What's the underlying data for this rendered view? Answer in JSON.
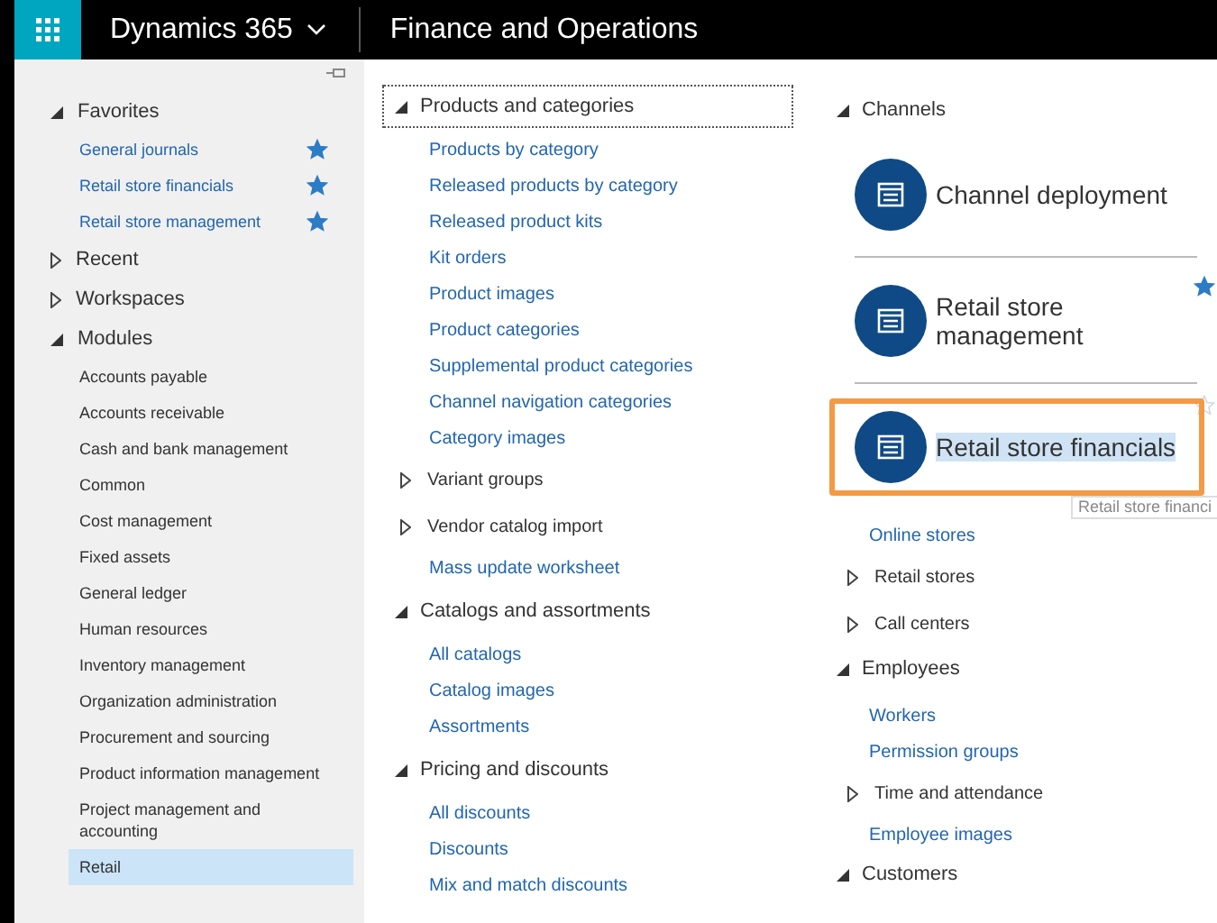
{
  "header": {
    "app_name": "Dynamics 365",
    "module_title": "Finance and Operations"
  },
  "sidebar": {
    "sections": [
      {
        "label": "Favorites",
        "expanded": true,
        "items": [
          {
            "label": "General journals",
            "starred": true,
            "selected": false
          },
          {
            "label": "Retail store financials",
            "starred": true,
            "selected": false
          },
          {
            "label": "Retail store management",
            "starred": true,
            "selected": false
          }
        ]
      },
      {
        "label": "Recent",
        "expanded": false
      },
      {
        "label": "Workspaces",
        "expanded": false
      },
      {
        "label": "Modules",
        "expanded": true,
        "items": [
          {
            "label": "Accounts payable",
            "starred": false,
            "selected": false
          },
          {
            "label": "Accounts receivable",
            "starred": false,
            "selected": false
          },
          {
            "label": "Cash and bank management",
            "starred": false,
            "selected": false
          },
          {
            "label": "Common",
            "starred": false,
            "selected": false
          },
          {
            "label": "Cost management",
            "starred": false,
            "selected": false
          },
          {
            "label": "Fixed assets",
            "starred": false,
            "selected": false
          },
          {
            "label": "General ledger",
            "starred": false,
            "selected": false
          },
          {
            "label": "Human resources",
            "starred": false,
            "selected": false
          },
          {
            "label": "Inventory management",
            "starred": false,
            "selected": false
          },
          {
            "label": "Organization administration",
            "starred": false,
            "selected": false
          },
          {
            "label": "Procurement and sourcing",
            "starred": false,
            "selected": false
          },
          {
            "label": "Product information management",
            "starred": false,
            "selected": false
          },
          {
            "label": "Project management and accounting",
            "starred": false,
            "selected": false
          },
          {
            "label": "Retail",
            "starred": false,
            "selected": true
          }
        ]
      }
    ]
  },
  "middle": {
    "sections": [
      {
        "label": "Products and categories",
        "expanded": true,
        "focused": true,
        "items": [
          {
            "kind": "link",
            "label": "Products by category"
          },
          {
            "kind": "link",
            "label": "Released products by category"
          },
          {
            "kind": "link",
            "label": "Released product kits"
          },
          {
            "kind": "link",
            "label": "Kit orders"
          },
          {
            "kind": "link",
            "label": "Product images"
          },
          {
            "kind": "link",
            "label": "Product categories"
          },
          {
            "kind": "link",
            "label": "Supplemental product categories"
          },
          {
            "kind": "link",
            "label": "Channel navigation categories"
          },
          {
            "kind": "link",
            "label": "Category images"
          },
          {
            "kind": "group",
            "label": "Variant groups",
            "expanded": false
          },
          {
            "kind": "group",
            "label": "Vendor catalog import",
            "expanded": false
          },
          {
            "kind": "link",
            "label": "Mass update worksheet"
          }
        ]
      },
      {
        "label": "Catalogs and assortments",
        "expanded": true,
        "focused": false,
        "items": [
          {
            "kind": "link",
            "label": "All catalogs"
          },
          {
            "kind": "link",
            "label": "Catalog images"
          },
          {
            "kind": "link",
            "label": "Assortments"
          }
        ]
      },
      {
        "label": "Pricing and discounts",
        "expanded": true,
        "focused": false,
        "items": [
          {
            "kind": "link",
            "label": "All discounts"
          },
          {
            "kind": "link",
            "label": "Discounts"
          },
          {
            "kind": "link",
            "label": "Mix and match discounts"
          }
        ]
      }
    ]
  },
  "right": {
    "sections": [
      {
        "label": "Channels",
        "expanded": true,
        "tiles": [
          {
            "label": "Channel deployment",
            "starred": false,
            "highlighted": false
          },
          {
            "label": "Retail store management",
            "starred": true,
            "highlighted": false
          },
          {
            "label": "Retail store financials",
            "starred": false,
            "highlighted": true,
            "tooltip": "Retail store financi"
          }
        ],
        "items": [
          {
            "kind": "link",
            "label": "Online stores"
          },
          {
            "kind": "group",
            "label": "Retail stores",
            "expanded": false
          },
          {
            "kind": "group",
            "label": "Call centers",
            "expanded": false
          }
        ]
      },
      {
        "label": "Employees",
        "expanded": true,
        "items": [
          {
            "kind": "link",
            "label": "Workers"
          },
          {
            "kind": "link",
            "label": "Permission groups"
          },
          {
            "kind": "group",
            "label": "Time and attendance",
            "expanded": false
          },
          {
            "kind": "link",
            "label": "Employee images"
          }
        ]
      },
      {
        "label": "Customers",
        "expanded": true
      }
    ]
  }
}
